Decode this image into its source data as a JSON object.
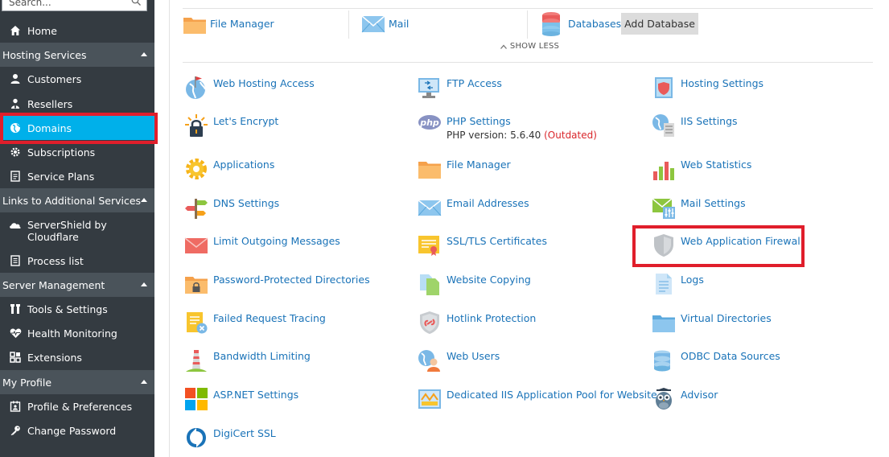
{
  "sidebar": {
    "search_placeholder": "Search...",
    "items": {
      "home": "Home",
      "hosting_services": "Hosting Services",
      "customers": "Customers",
      "resellers": "Resellers",
      "domains": "Domains",
      "subscriptions": "Subscriptions",
      "service_plans": "Service Plans",
      "links_additional": "Links to Additional Services",
      "servershield": "ServerShield by Cloudflare",
      "process_list": "Process list",
      "server_management": "Server Management",
      "tools_settings": "Tools & Settings",
      "health_monitoring": "Health Monitoring",
      "extensions": "Extensions",
      "my_profile": "My Profile",
      "profile_preferences": "Profile & Preferences",
      "change_password": "Change Password"
    },
    "active_color": "#00b0ea"
  },
  "top_row": {
    "file_manager": "File Manager",
    "mail": "Mail",
    "databases": "Databases",
    "add_database": "Add Database"
  },
  "show_less": "SHOW LESS",
  "tools": {
    "web_hosting_access": "Web Hosting Access",
    "ftp_access": "FTP Access",
    "hosting_settings": "Hosting Settings",
    "lets_encrypt": "Let's Encrypt",
    "php_settings": "PHP Settings",
    "php_version": "PHP version: 5.6.40",
    "php_outdated": "(Outdated)",
    "iis_settings": "IIS Settings",
    "applications": "Applications",
    "file_manager": "File Manager",
    "web_statistics": "Web Statistics",
    "dns_settings": "DNS Settings",
    "email_addresses": "Email Addresses",
    "mail_settings": "Mail Settings",
    "limit_outgoing": "Limit Outgoing Messages",
    "ssl_tls": "SSL/TLS Certificates",
    "waf": "Web Application Firewall",
    "password_protected": "Password-Protected Directories",
    "website_copying": "Website Copying",
    "logs": "Logs",
    "failed_request": "Failed Request Tracing",
    "hotlink": "Hotlink Protection",
    "virtual_dirs": "Virtual Directories",
    "bandwidth": "Bandwidth Limiting",
    "web_users": "Web Users",
    "odbc": "ODBC Data Sources",
    "aspnet": "ASP.NET Settings",
    "iis_pool": "Dedicated IIS Application Pool for Website",
    "advisor": "Advisor",
    "digicert": "DigiCert SSL"
  },
  "colors": {
    "link": "#1a73b8",
    "highlight": "#e01e2b"
  }
}
